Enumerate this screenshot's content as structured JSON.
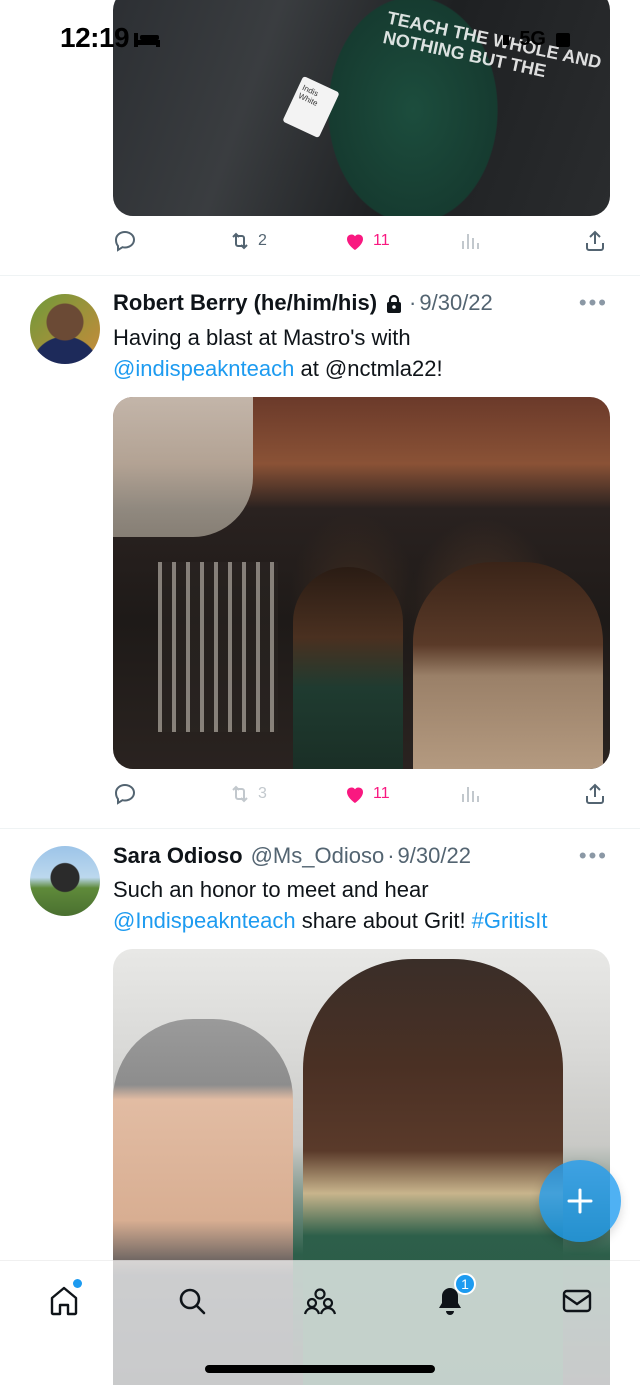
{
  "status_bar": {
    "time": "12:19",
    "network": "5G"
  },
  "photos": {
    "top_text": "TEACH THE WHOLE AND NOTHING BUT THE",
    "top_badge": "Indis White"
  },
  "tweets": [
    {
      "actions": {
        "replies": "",
        "retweets": "2",
        "likes": "11",
        "views": ""
      }
    },
    {
      "name": "Robert Berry (he/him/his)",
      "date": "9/30/22",
      "text_1": "Having a blast at Mastro's with",
      "mention_1": "@indispeaknteach",
      "text_2": " at @nctmla22!",
      "actions": {
        "replies": "",
        "retweets": "3",
        "likes": "11",
        "views": ""
      }
    },
    {
      "name": "Sara Odioso",
      "handle": "@Ms_Odioso",
      "date": "9/30/22",
      "text_1": "Such an honor to meet and hear",
      "mention_1": "@Indispeaknteach",
      "text_2": " share about Grit! ",
      "hashtag": "#GritisIt"
    }
  ],
  "nav": {
    "notifications_count": "1"
  },
  "colors": {
    "accent": "#1d9bf0",
    "like": "#f91880",
    "muted": "#536471"
  },
  "icons": [
    "reply-icon",
    "retweet-icon",
    "heart-icon",
    "views-icon",
    "share-icon",
    "lock-icon",
    "more-icon",
    "compose-icon",
    "home-icon",
    "search-icon",
    "communities-icon",
    "bell-icon",
    "mail-icon"
  ]
}
